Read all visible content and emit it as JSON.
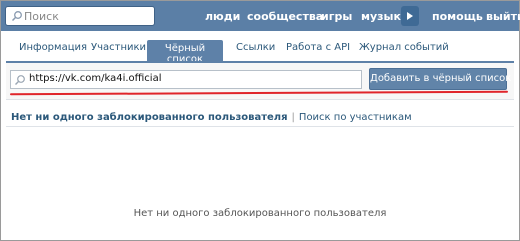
{
  "header": {
    "search_placeholder": "Поиск",
    "nav": [
      "люди",
      "сообщества",
      "игры",
      "музыка",
      "помощь",
      "выйти"
    ]
  },
  "tabs": [
    "Информация",
    "Участники",
    "Чёрный список",
    "Ссылки",
    "Работа с API",
    "Журнал событий"
  ],
  "blacklist": {
    "url_value": "https://vk.com/ka4i.official",
    "add_button": "Добавить в чёрный список"
  },
  "subheader": {
    "title": "Нет ни одного заблокированного пользователя",
    "separator": "|",
    "link": "Поиск по участникам"
  },
  "empty_message": "Нет ни одного заблокированного пользователя",
  "colors": {
    "header": "#5b7fa6",
    "accent": "#5e81a8",
    "highlight": "#e0252b"
  }
}
